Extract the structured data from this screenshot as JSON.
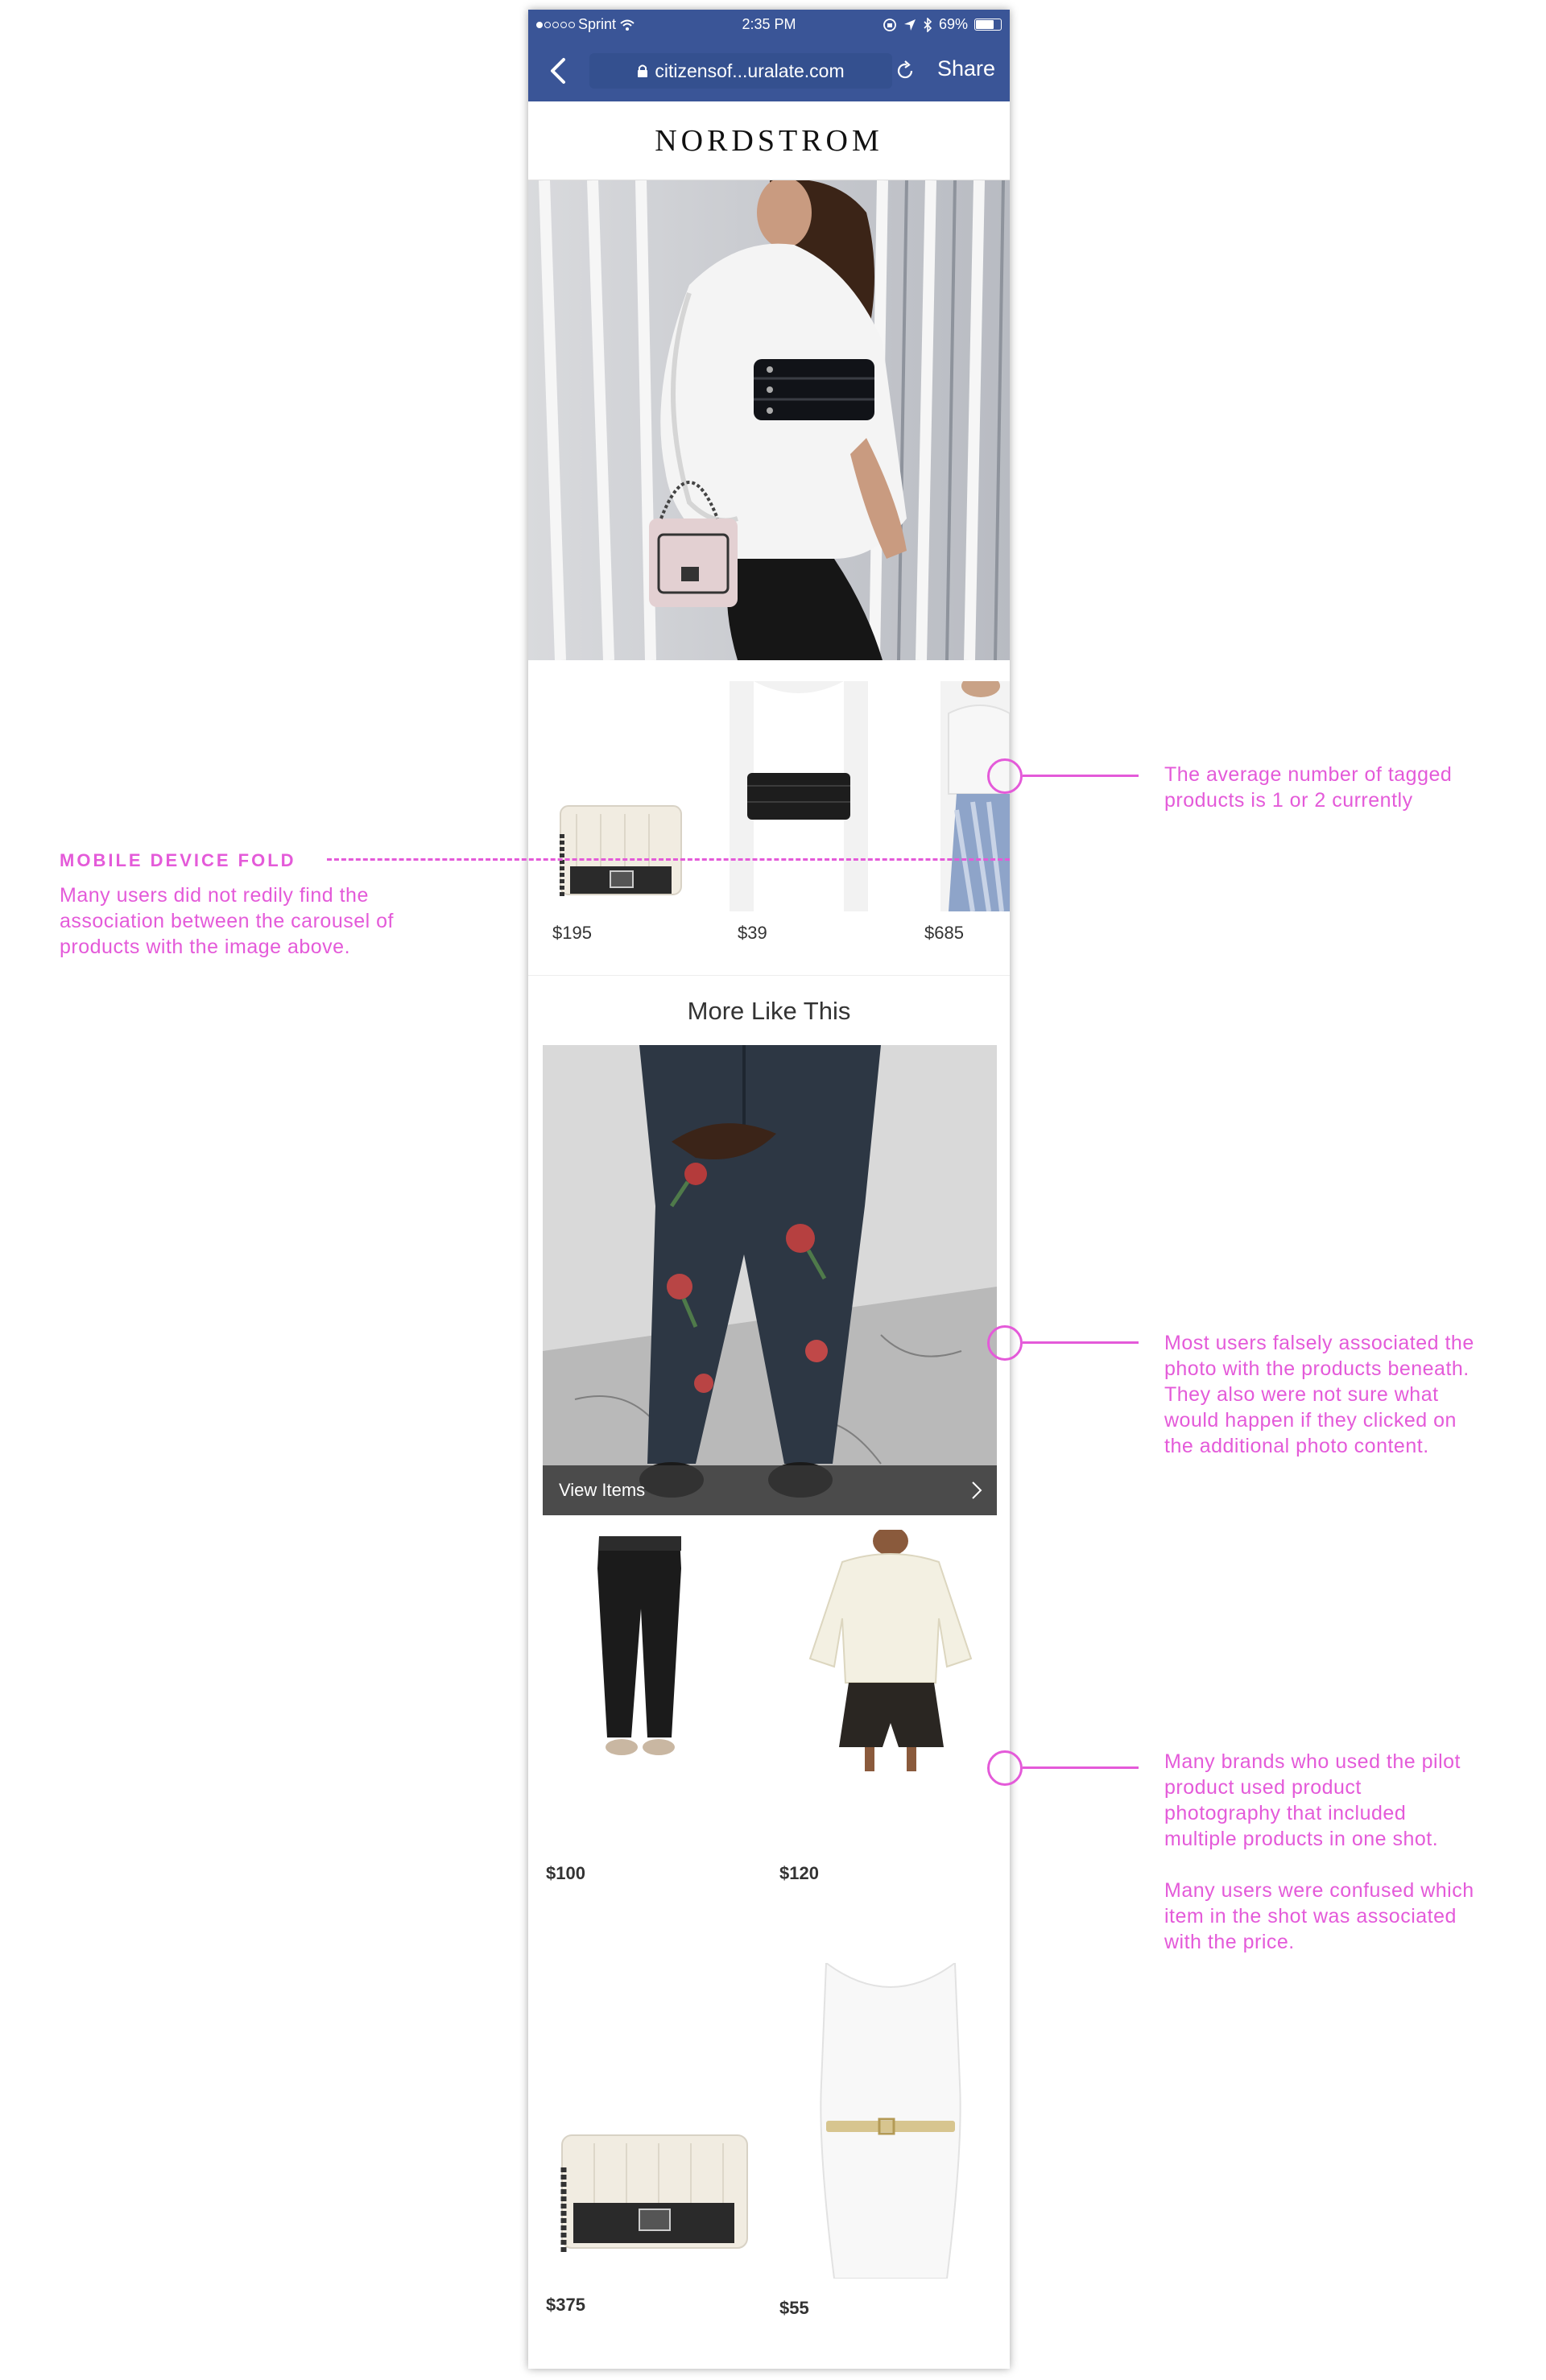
{
  "status_bar": {
    "carrier": "Sprint",
    "time": "2:35 PM",
    "battery": "69%",
    "battery_level": 0.69
  },
  "browser": {
    "url": "citizensof...uralate.com",
    "share_label": "Share"
  },
  "brand": {
    "name": "NORDSTROM"
  },
  "carousel": {
    "items": [
      {
        "price": "$195",
        "icon": "handbag"
      },
      {
        "price": "$39",
        "icon": "belt"
      },
      {
        "price": "$685",
        "icon": "dress"
      }
    ]
  },
  "more_like_this": {
    "title": "More Like This",
    "view_items_label": "View Items"
  },
  "grid": {
    "items": [
      {
        "price": "$100",
        "icon": "pants"
      },
      {
        "price": "$120",
        "icon": "sweater-and-shorts"
      },
      {
        "price": "$375",
        "icon": "handbag"
      },
      {
        "price": "$55",
        "icon": "belt-on-mannequin"
      }
    ]
  },
  "annotations": {
    "fold_heading": "MOBILE DEVICE FOLD",
    "fold_lines": [
      "Many users did not redily find the",
      "association between the carousel of",
      "products with the image above."
    ],
    "tagged_lines": [
      "The average number of tagged",
      "products is 1 or 2 currently"
    ],
    "photo_lines": [
      "Most users falsely associated the",
      "photo with the products beneath.",
      "They also were not sure what",
      "would happen if they clicked on",
      "the additional photo content."
    ],
    "brands_lines": [
      "Many brands who used the pilot",
      "product used product",
      "photography that included",
      "multiple products in one shot."
    ],
    "confused_lines": [
      "Many users were confused which",
      "item in the shot was associated",
      "with the price."
    ]
  },
  "colors": {
    "browser_bar": "#3a5597",
    "annotation": "#e45ad9"
  }
}
